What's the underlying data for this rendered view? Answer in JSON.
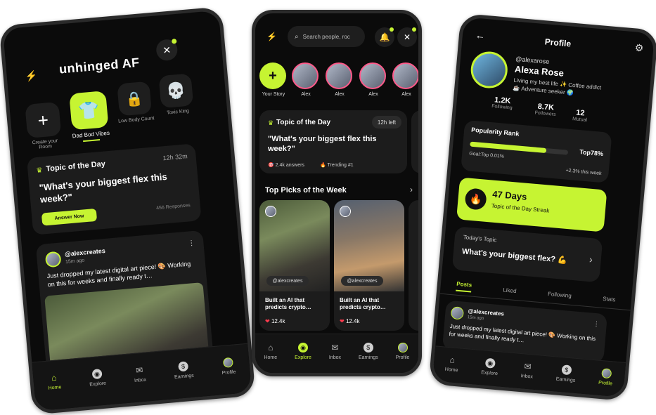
{
  "colors": {
    "accent": "#c6f432",
    "bg": "#0b0b0b",
    "card": "#1c1c1c"
  },
  "p1": {
    "logo": "unhinged AF",
    "stories": [
      {
        "label": "Create your Room",
        "icon": "plus-icon"
      },
      {
        "label": "Dad Bod Vibes",
        "icon": "hoodie-icon"
      },
      {
        "label": "Low Body Count",
        "icon": "lock-heart-icon"
      },
      {
        "label": "Toxic King",
        "icon": "skull-icon"
      }
    ],
    "topic": {
      "title": "Topic of the Day",
      "time": "12h 32m",
      "question": "\"What's your biggest flex this week?\"",
      "button": "Answer Now",
      "responses": "456 Responses"
    },
    "post": {
      "user": "@alexcreates",
      "time": "15m ago",
      "text": "Just dropped my latest digital art piece! 🎨 Working on this for weeks and finally ready t…"
    },
    "nav": [
      "Home",
      "Explore",
      "Inbox",
      "Earnings",
      "Profile"
    ]
  },
  "p2": {
    "search_placeholder": "Search people, roc",
    "stories": [
      {
        "label": "Your Story"
      },
      {
        "label": "Alex"
      },
      {
        "label": "Alex"
      },
      {
        "label": "Alex"
      },
      {
        "label": "Alex"
      }
    ],
    "topic": {
      "title": "Topic of the Day",
      "time": "12h left",
      "question": "\"What's your biggest flex this week?\"",
      "answers": "2.4k answers",
      "trending": "Trending #1"
    },
    "section": "Top Picks of the Week",
    "picks": [
      {
        "user": "@alexcreates",
        "title": "Built an AI that predicts crypto…",
        "likes": "12.4k"
      },
      {
        "user": "@alexcreates",
        "title": "Built an AI that predicts crypto…",
        "likes": "12.4k"
      }
    ],
    "nav": [
      "Home",
      "Explore",
      "Inbox",
      "Earnings",
      "Profile"
    ]
  },
  "p3": {
    "title": "Profile",
    "handle": "@alexarose",
    "name": "Alexa Rose",
    "bio": "Living my best life ✨ Coffee addict ☕ Adventure seeker 🌍",
    "stats": [
      {
        "value": "1.2K",
        "label": "Following"
      },
      {
        "value": "8.7K",
        "label": "Followers"
      },
      {
        "value": "12",
        "label": "Mutual"
      }
    ],
    "rank": {
      "title": "Popularity Rank",
      "top": "Top78%",
      "goal": "Goal:Top 0.01%",
      "change": "+2.3% this week",
      "progress": 0.78
    },
    "streak": {
      "days": "47 Days",
      "label": "Topic of the Day Streak"
    },
    "today": {
      "label": "Today's Topic",
      "question": "What's your biggest flex? 💪"
    },
    "tabs": [
      "Posts",
      "Liked",
      "Following",
      "Stats"
    ],
    "post": {
      "user": "@alexcreates",
      "time": "15m ago",
      "text": "Just dropped my latest digital art piece! 🎨 Working on this for weeks and finally ready t…"
    },
    "nav": [
      "Home",
      "Explore",
      "Inbox",
      "Earnings",
      "Profile"
    ]
  }
}
